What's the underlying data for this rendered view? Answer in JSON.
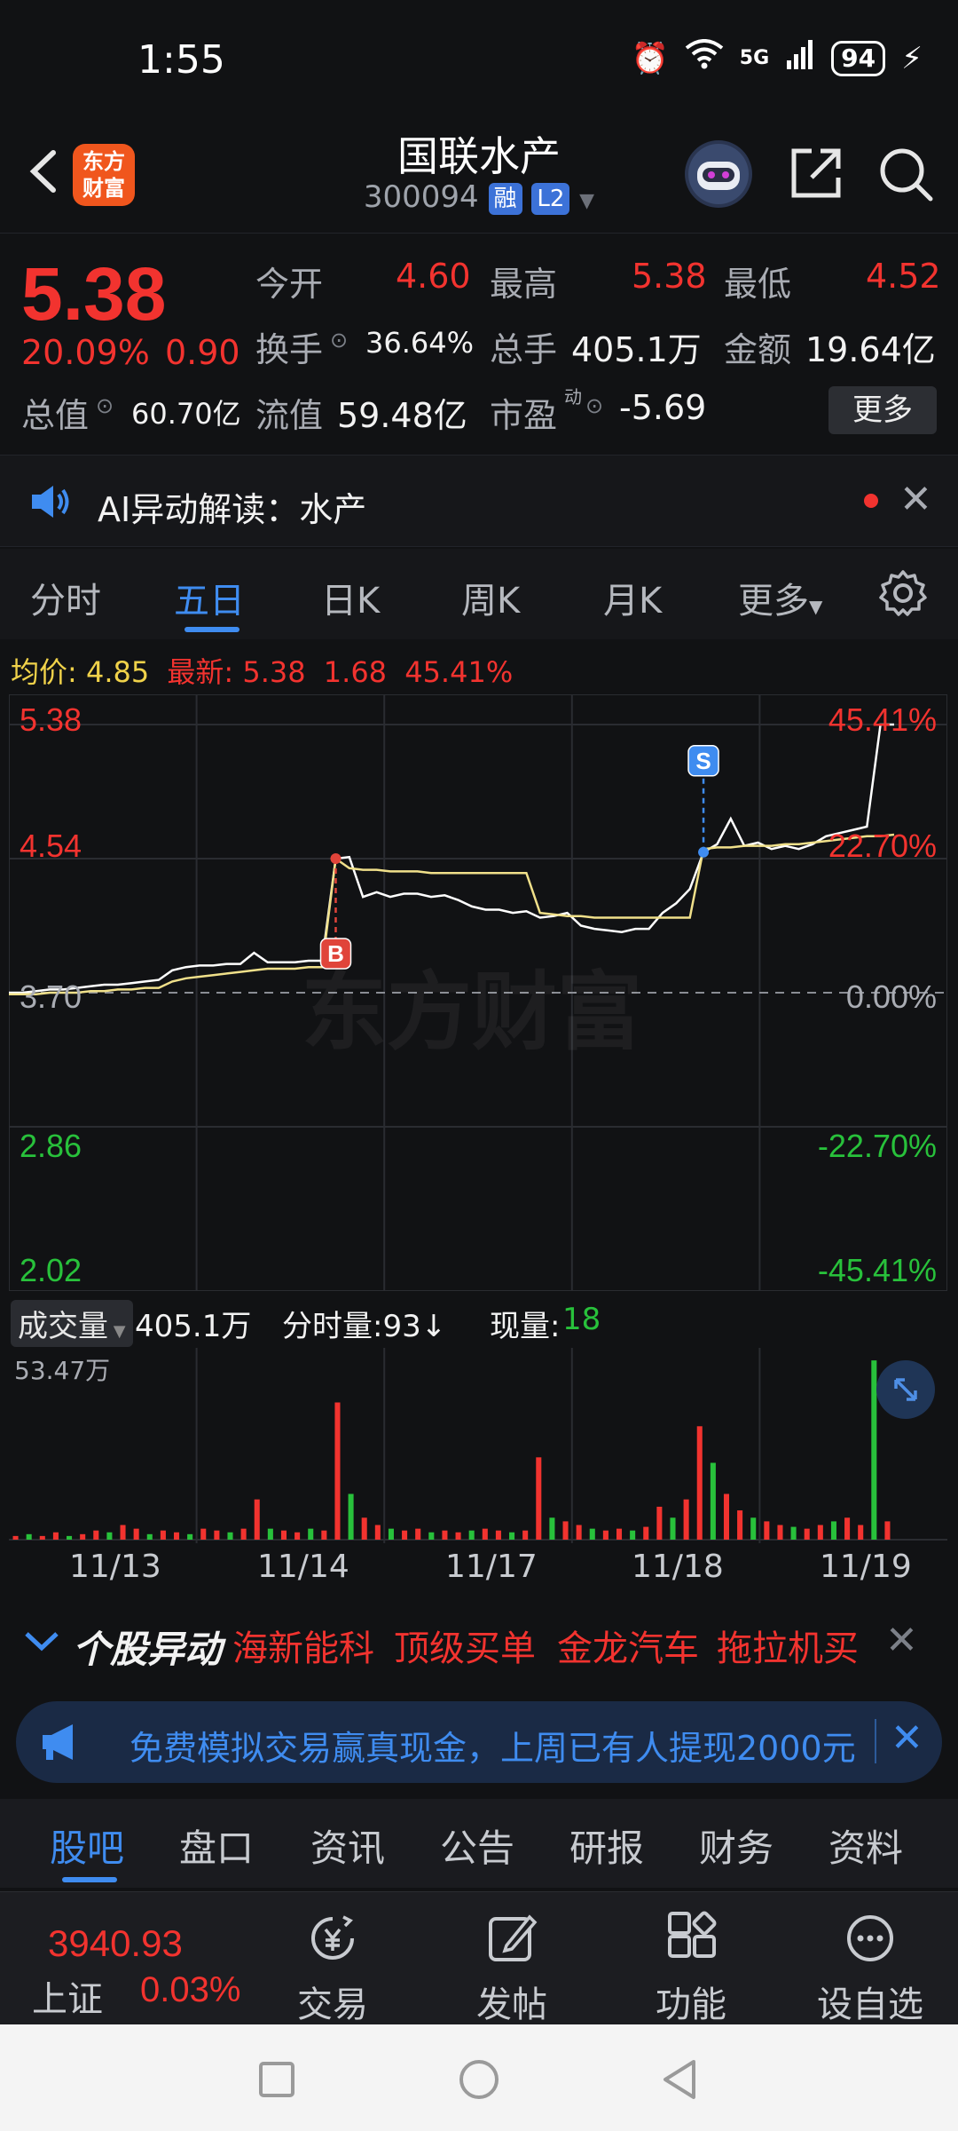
{
  "status_bar": {
    "time": "1:55",
    "network": "5G",
    "battery": "94"
  },
  "header": {
    "logo_line1": "东方",
    "logo_line2": "财富",
    "stock_name": "国联水产",
    "stock_code": "300094",
    "tag_margin": "融",
    "tag_level": "L2"
  },
  "quote": {
    "price": "5.38",
    "change_pct": "20.09%",
    "change_amt": "0.90",
    "open_label": "今开",
    "open": "4.60",
    "high_label": "最高",
    "high": "5.38",
    "low_label": "最低",
    "low": "4.52",
    "turnover_label": "换手",
    "turnover": "36.64%",
    "volume_label": "总手",
    "volume": "405.1万",
    "amount_label": "金额",
    "amount": "19.64亿",
    "mktcap_label": "总值",
    "mktcap": "60.70亿",
    "float_label": "流值",
    "float": "59.48亿",
    "pe_label": "市盈",
    "pe_sup": "动",
    "pe": "-5.69",
    "more": "更多"
  },
  "ai_bar": {
    "text": "AI异动解读：水产"
  },
  "chart_tabs": [
    "分时",
    "五日",
    "日K",
    "周K",
    "月K",
    "更多"
  ],
  "chart_header": {
    "avg_label": "均价:",
    "avg": "4.85",
    "latest_label": "最新:",
    "latest": "5.38",
    "latest_chg": "1.68",
    "latest_pct": "45.41%"
  },
  "chart_data": {
    "type": "line",
    "x_dates": [
      "11/13",
      "11/14",
      "11/17",
      "11/18",
      "11/19"
    ],
    "y_left_ticks": [
      "5.38",
      "4.54",
      "3.70",
      "2.86",
      "2.02"
    ],
    "y_right_ticks": [
      "45.41%",
      "22.70%",
      "0.00%",
      "-22.70%",
      "-45.41%"
    ],
    "ylim": [
      2.02,
      5.38
    ],
    "baseline": 3.7,
    "series": [
      {
        "values": [
          3.7,
          3.7,
          3.71,
          3.72,
          3.72,
          3.73,
          3.74,
          3.75,
          3.75,
          3.76,
          3.77,
          3.78,
          3.84,
          3.86,
          3.87,
          3.87,
          3.88,
          3.88,
          3.95,
          3.89,
          3.89,
          3.89,
          3.9,
          3.9,
          4.54,
          4.55,
          4.3,
          4.33,
          4.3,
          4.32,
          4.32,
          4.3,
          4.31,
          4.28,
          4.24,
          4.22,
          4.22,
          4.2,
          4.21,
          4.17,
          4.18,
          4.2,
          4.12,
          4.1,
          4.09,
          4.08,
          4.1,
          4.1,
          4.2,
          4.26,
          4.35,
          4.58,
          4.63,
          4.79,
          4.62,
          4.64,
          4.6,
          4.62,
          4.6,
          4.63,
          4.68,
          4.7,
          4.72,
          4.74,
          5.38,
          5.38
        ]
      },
      {
        "values": [
          3.69,
          3.69,
          3.69,
          3.7,
          3.7,
          3.7,
          3.71,
          3.71,
          3.72,
          3.72,
          3.73,
          3.73,
          3.77,
          3.79,
          3.8,
          3.81,
          3.82,
          3.83,
          3.84,
          3.85,
          3.85,
          3.85,
          3.86,
          3.86,
          4.54,
          4.48,
          4.47,
          4.47,
          4.46,
          4.46,
          4.46,
          4.45,
          4.45,
          4.45,
          4.45,
          4.45,
          4.45,
          4.45,
          4.45,
          4.2,
          4.19,
          4.18,
          4.18,
          4.17,
          4.17,
          4.17,
          4.17,
          4.17,
          4.17,
          4.17,
          4.17,
          4.6,
          4.61,
          4.61,
          4.62,
          4.62,
          4.62,
          4.63,
          4.63,
          4.64,
          4.65,
          4.66,
          4.67,
          4.68,
          4.68,
          4.69
        ]
      }
    ],
    "markers": [
      {
        "label": "B",
        "x_index": 24,
        "price": 4.54
      },
      {
        "label": "S",
        "x_index": 51,
        "price": 4.58
      }
    ],
    "legend_colors": {
      "price": "#ffffff",
      "avg": "#f0e08a"
    }
  },
  "volume": {
    "label": "成交量",
    "total": "405.1万",
    "tick_label": "分时量:93↓",
    "now_label": "现量:",
    "now": "18",
    "max_label": "53.47万",
    "bars": [
      0.02,
      0.03,
      0.02,
      0.04,
      0.02,
      0.03,
      0.05,
      0.04,
      0.08,
      0.06,
      0.03,
      0.05,
      0.04,
      0.03,
      0.06,
      0.05,
      0.04,
      0.06,
      0.22,
      0.06,
      0.05,
      0.04,
      0.06,
      0.05,
      0.75,
      0.25,
      0.12,
      0.08,
      0.06,
      0.05,
      0.06,
      0.04,
      0.05,
      0.04,
      0.05,
      0.06,
      0.05,
      0.04,
      0.05,
      0.45,
      0.12,
      0.1,
      0.08,
      0.06,
      0.05,
      0.06,
      0.05,
      0.07,
      0.18,
      0.12,
      0.22,
      0.62,
      0.42,
      0.25,
      0.16,
      0.12,
      0.1,
      0.08,
      0.07,
      0.06,
      0.08,
      0.1,
      0.12,
      0.08,
      0.98,
      0.1
    ]
  },
  "alerts": {
    "title": "个股异动",
    "items": [
      "海新能科",
      "顶级买单",
      "金龙汽车",
      "拖拉机买"
    ]
  },
  "ad": {
    "text": "免费模拟交易赢真现金，上周已有人提现2000元"
  },
  "bottom_tabs": [
    "股吧",
    "盘口",
    "资讯",
    "公告",
    "研报",
    "财务",
    "资料"
  ],
  "bottom_nav": {
    "index_price": "3940.93",
    "index_label": "上证",
    "index_pct": "0.03%",
    "items": [
      "交易",
      "发帖",
      "功能",
      "设自选"
    ]
  },
  "watermark": "东方财富"
}
